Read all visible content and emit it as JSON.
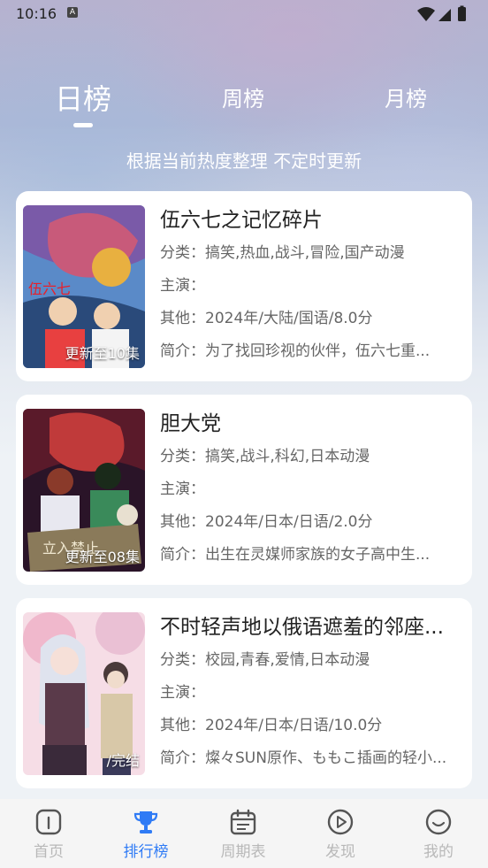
{
  "status_bar": {
    "time": "10:16",
    "app_badge": "A"
  },
  "tabs": [
    {
      "label": "日榜",
      "active": true
    },
    {
      "label": "周榜",
      "active": false
    },
    {
      "label": "月榜",
      "active": false
    }
  ],
  "subtitle": "根据当前热度整理 不定时更新",
  "items": [
    {
      "title": "伍六七之记忆碎片",
      "category": "分类：搞笑,热血,战斗,冒险,国产动漫",
      "cast": "主演：",
      "other": "其他：2024年/大陆/国语/8.0分",
      "intro": "简介：为了找回珍视的伙伴，伍六七重...",
      "badge": "更新至10集",
      "poster_colors": [
        "#7a5aa8",
        "#c85a7a",
        "#e8b040",
        "#4aa0d8"
      ]
    },
    {
      "title": "胆大党",
      "category": "分类：搞笑,战斗,科幻,日本动漫",
      "cast": "主演：",
      "other": "其他：2024年/日本/日语/2.0分",
      "intro": "简介：出生在灵媒师家族的女子高中生...",
      "badge": "更新至08集",
      "poster_colors": [
        "#3a1a30",
        "#c03a3a",
        "#3a8a5a",
        "#e8d0a0"
      ]
    },
    {
      "title": "不时轻声地以俄语遮羞的邻座...",
      "category": "分类：校园,青春,爱情,日本动漫",
      "cast": "主演：",
      "other": "其他：2024年/日本/日语/10.0分",
      "intro": "简介：燦々SUN原作、ももこ插画的轻小...",
      "badge": "/完结",
      "poster_colors": [
        "#f4d0dc",
        "#d8a0c0",
        "#6a4a5a",
        "#c0c8e0"
      ]
    }
  ],
  "nav": [
    {
      "label": "首页",
      "icon": "home-icon",
      "active": false
    },
    {
      "label": "排行榜",
      "icon": "trophy-icon",
      "active": true
    },
    {
      "label": "周期表",
      "icon": "calendar-icon",
      "active": false
    },
    {
      "label": "发现",
      "icon": "play-circle-icon",
      "active": false
    },
    {
      "label": "我的",
      "icon": "smile-icon",
      "active": false
    }
  ],
  "colors": {
    "accent": "#2f7bf5",
    "nav_inactive": "#b8b8b8"
  }
}
